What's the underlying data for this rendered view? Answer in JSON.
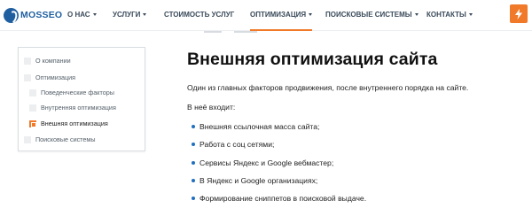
{
  "header": {
    "logo_text": "MOSSEO",
    "nav": [
      {
        "label": "О НАС",
        "dropdown": true,
        "active": false
      },
      {
        "label": "УСЛУГИ",
        "dropdown": true,
        "active": false
      },
      {
        "label": "СТОИМОСТЬ УСЛУГ",
        "dropdown": false,
        "active": false
      },
      {
        "label": "ОПТИМИЗАЦИЯ",
        "dropdown": true,
        "active": true
      },
      {
        "label": "ПОИСКОВЫЕ СИСТЕМЫ",
        "dropdown": true,
        "active": false
      },
      {
        "label": "КОНТАКТЫ",
        "dropdown": true,
        "active": false
      }
    ],
    "action_icon": "lightning-icon"
  },
  "sidebar": {
    "items": [
      {
        "label": "О компании",
        "level": 0,
        "current": false
      },
      {
        "label": "Оптимизация",
        "level": 0,
        "current": false
      },
      {
        "label": "Поведенческие факторы",
        "level": 1,
        "current": false
      },
      {
        "label": "Внутренняя оптимизация",
        "level": 1,
        "current": false
      },
      {
        "label": "Внешняя оптимизация",
        "level": 1,
        "current": true
      },
      {
        "label": "Поисковые системы",
        "level": 0,
        "current": false
      }
    ]
  },
  "main": {
    "title": "Внешняя оптимизация сайта",
    "intro": "Один из главных факторов продвижения, после внутреннего порядка на сайте.",
    "includes_label": "В неё входит:",
    "bullets": [
      "Внешняя ссылочная масса сайта;",
      "Работа с соц сетями;",
      "Сервисы Яндекс и Google вебмастер;",
      "В Яндекс и Google организациях;",
      "Формирование сниппетов в поисковой выдаче."
    ]
  },
  "colors": {
    "accent": "#f07a2a",
    "brand": "#1f5fa0",
    "bullet": "#1f6fc0"
  }
}
